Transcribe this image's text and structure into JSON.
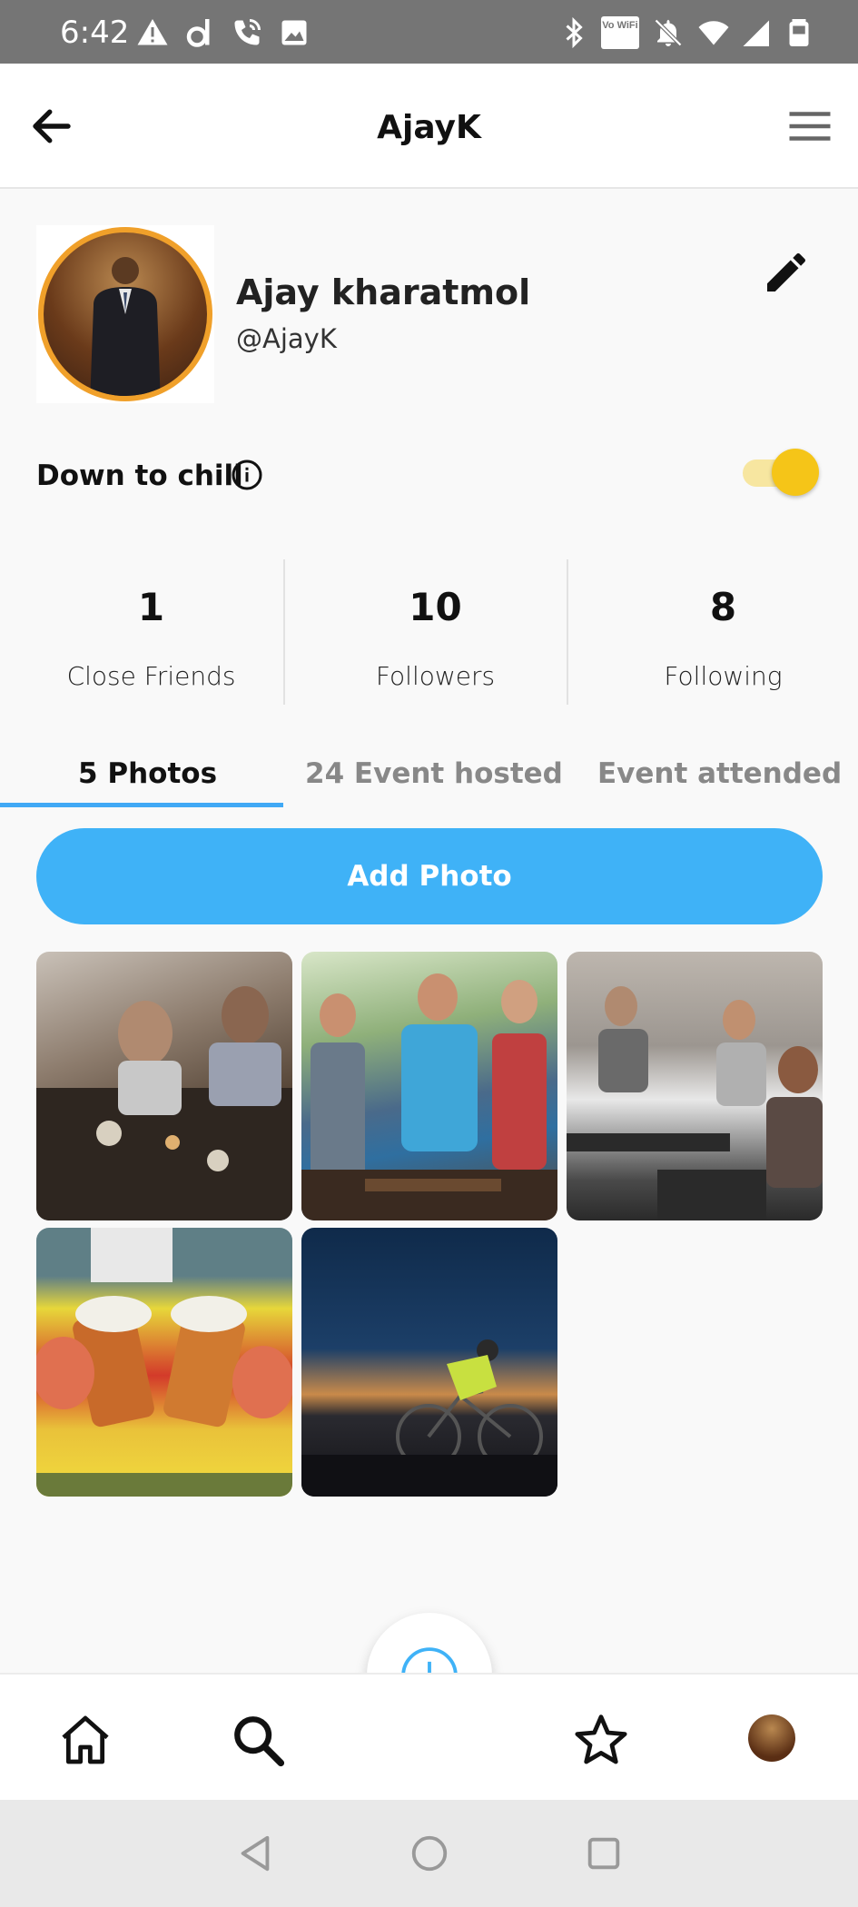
{
  "status_bar": {
    "time": "6:42",
    "left_icons": [
      "warning-icon",
      "d-icon",
      "wifi-calling-icon",
      "image-icon"
    ],
    "right_icons": [
      "bluetooth-icon",
      "vowifi-icon",
      "bell-muted-icon",
      "wifi-icon",
      "signal-icon",
      "battery-icon"
    ],
    "vowifi_label": "Vo WiFi"
  },
  "app_bar": {
    "title": "AjayK"
  },
  "profile": {
    "name": "Ajay kharatmol",
    "handle": "@AjayK",
    "down_to_chill_label": "Down to chill",
    "down_to_chill_on": true
  },
  "stats": [
    {
      "value": "1",
      "label": "Close Friends"
    },
    {
      "value": "10",
      "label": "Followers"
    },
    {
      "value": "8",
      "label": "Following"
    }
  ],
  "tabs": [
    {
      "label": "5 Photos",
      "active": true
    },
    {
      "label": "24 Event hosted",
      "active": false
    },
    {
      "label": "Event attended",
      "active": false
    }
  ],
  "add_photo_label": "Add Photo",
  "colors": {
    "accent_blue": "#3fb2f7",
    "toggle_yellow": "#f5c518",
    "avatar_ring": "#f0a02a"
  },
  "photos_count": 5
}
